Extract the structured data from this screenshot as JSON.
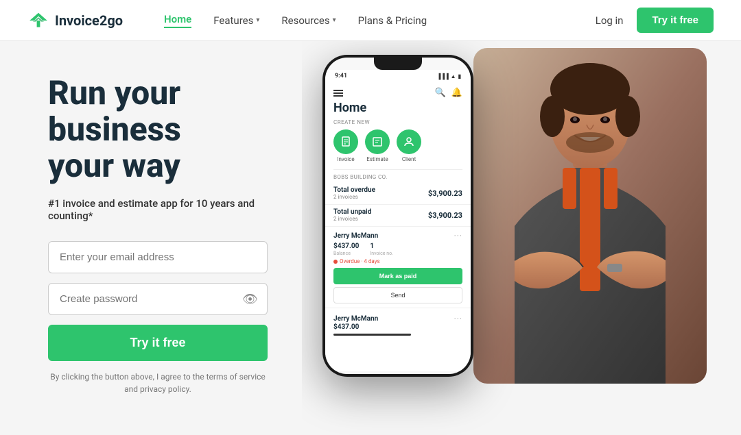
{
  "header": {
    "logo_text": "Invoice2go",
    "nav_items": [
      {
        "label": "Home",
        "active": true,
        "has_dropdown": false
      },
      {
        "label": "Features",
        "active": false,
        "has_dropdown": true
      },
      {
        "label": "Resources",
        "active": false,
        "has_dropdown": true
      },
      {
        "label": "Plans & Pricing",
        "active": false,
        "has_dropdown": false
      }
    ],
    "login_label": "Log in",
    "try_btn_label": "Try it free"
  },
  "hero": {
    "headline_line1": "Run your",
    "headline_line2": "business",
    "headline_line3": "your way",
    "subheadline": "#1 invoice and estimate app for 10 years and counting*",
    "email_placeholder": "Enter your email address",
    "password_placeholder": "Create password",
    "cta_btn": "Try it free",
    "disclaimer": "By clicking the button above, I agree to the terms of service\nand privacy policy."
  },
  "phone_screen": {
    "time": "9:41",
    "home_title": "Home",
    "create_new_label": "CREATE NEW",
    "create_icons": [
      {
        "label": "Invoice",
        "icon": "📄"
      },
      {
        "label": "Estimate",
        "icon": "📋"
      },
      {
        "label": "Client",
        "icon": "👤"
      }
    ],
    "company": "BOBS BUILDING CO.",
    "stats": [
      {
        "label": "Total overdue",
        "sub": "2 invoices",
        "amount": "$3,900.23"
      },
      {
        "label": "Total unpaid",
        "sub": "2 invoices",
        "amount": "$3,900.23"
      }
    ],
    "client1": {
      "name": "Jerry McMann",
      "balance": "$437.00",
      "balance_label": "Balance",
      "invoice_count": "1",
      "invoice_label": "Invoice no.",
      "overdue": "Overdue · 4 days",
      "mark_paid": "Mark as paid",
      "send": "Send"
    },
    "client2": {
      "name": "Jerry McMann",
      "balance": "$437.00"
    }
  }
}
